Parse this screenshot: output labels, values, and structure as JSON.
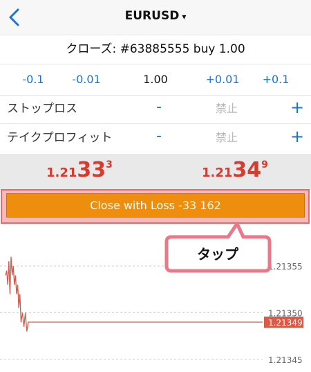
{
  "header": {
    "title": "EURUSD",
    "caret": "▾"
  },
  "subheader": {
    "text": "クローズ: #63885555 buy 1.00"
  },
  "volume": {
    "minus_1": "-0.1",
    "minus_2": "-0.01",
    "value": "1.00",
    "plus_1": "+0.01",
    "plus_2": "+0.1"
  },
  "stop_loss": {
    "label": "ストップロス",
    "minus": "-",
    "value": "禁止",
    "plus": "+"
  },
  "take_profit": {
    "label": "テイクプロフィット",
    "minus": "-",
    "value": "禁止",
    "plus": "+"
  },
  "bid": {
    "prefix": "1.21",
    "big": "33",
    "sup": "3"
  },
  "ask": {
    "prefix": "1.21",
    "big": "34",
    "sup": "9"
  },
  "close_button": {
    "label": "Close with Loss -33 162"
  },
  "callout": {
    "text": "タップ"
  },
  "chart_data": {
    "type": "line",
    "y_ticks": [
      "1.21355",
      "1.21350",
      "1.21345"
    ],
    "current_price_label": "1.21349",
    "ylim": [
      1.21345,
      1.21356
    ],
    "x": [
      0,
      1,
      2,
      3,
      4,
      5,
      6,
      7,
      8,
      9,
      10,
      11,
      12,
      13,
      14,
      15,
      16,
      17,
      18,
      19,
      20,
      21,
      22,
      23,
      24,
      25,
      26
    ],
    "values": [
      1.21354,
      1.213545,
      1.21353,
      1.213555,
      1.21352,
      1.21356,
      1.21354,
      1.21355,
      1.21353,
      1.21354,
      1.21352,
      1.21353,
      1.213505,
      1.21352,
      1.21349,
      1.2135,
      1.213485,
      1.2135,
      1.21348,
      1.21349,
      1.21349,
      1.21349,
      1.21349,
      1.21349,
      1.21349,
      1.21349,
      1.21349
    ],
    "color": "#d85a48",
    "grid": true
  },
  "colors": {
    "accent": "#1a73d9",
    "price": "#d83a2e",
    "button": "#ee8e0e",
    "highlight": "#e36b6b"
  }
}
